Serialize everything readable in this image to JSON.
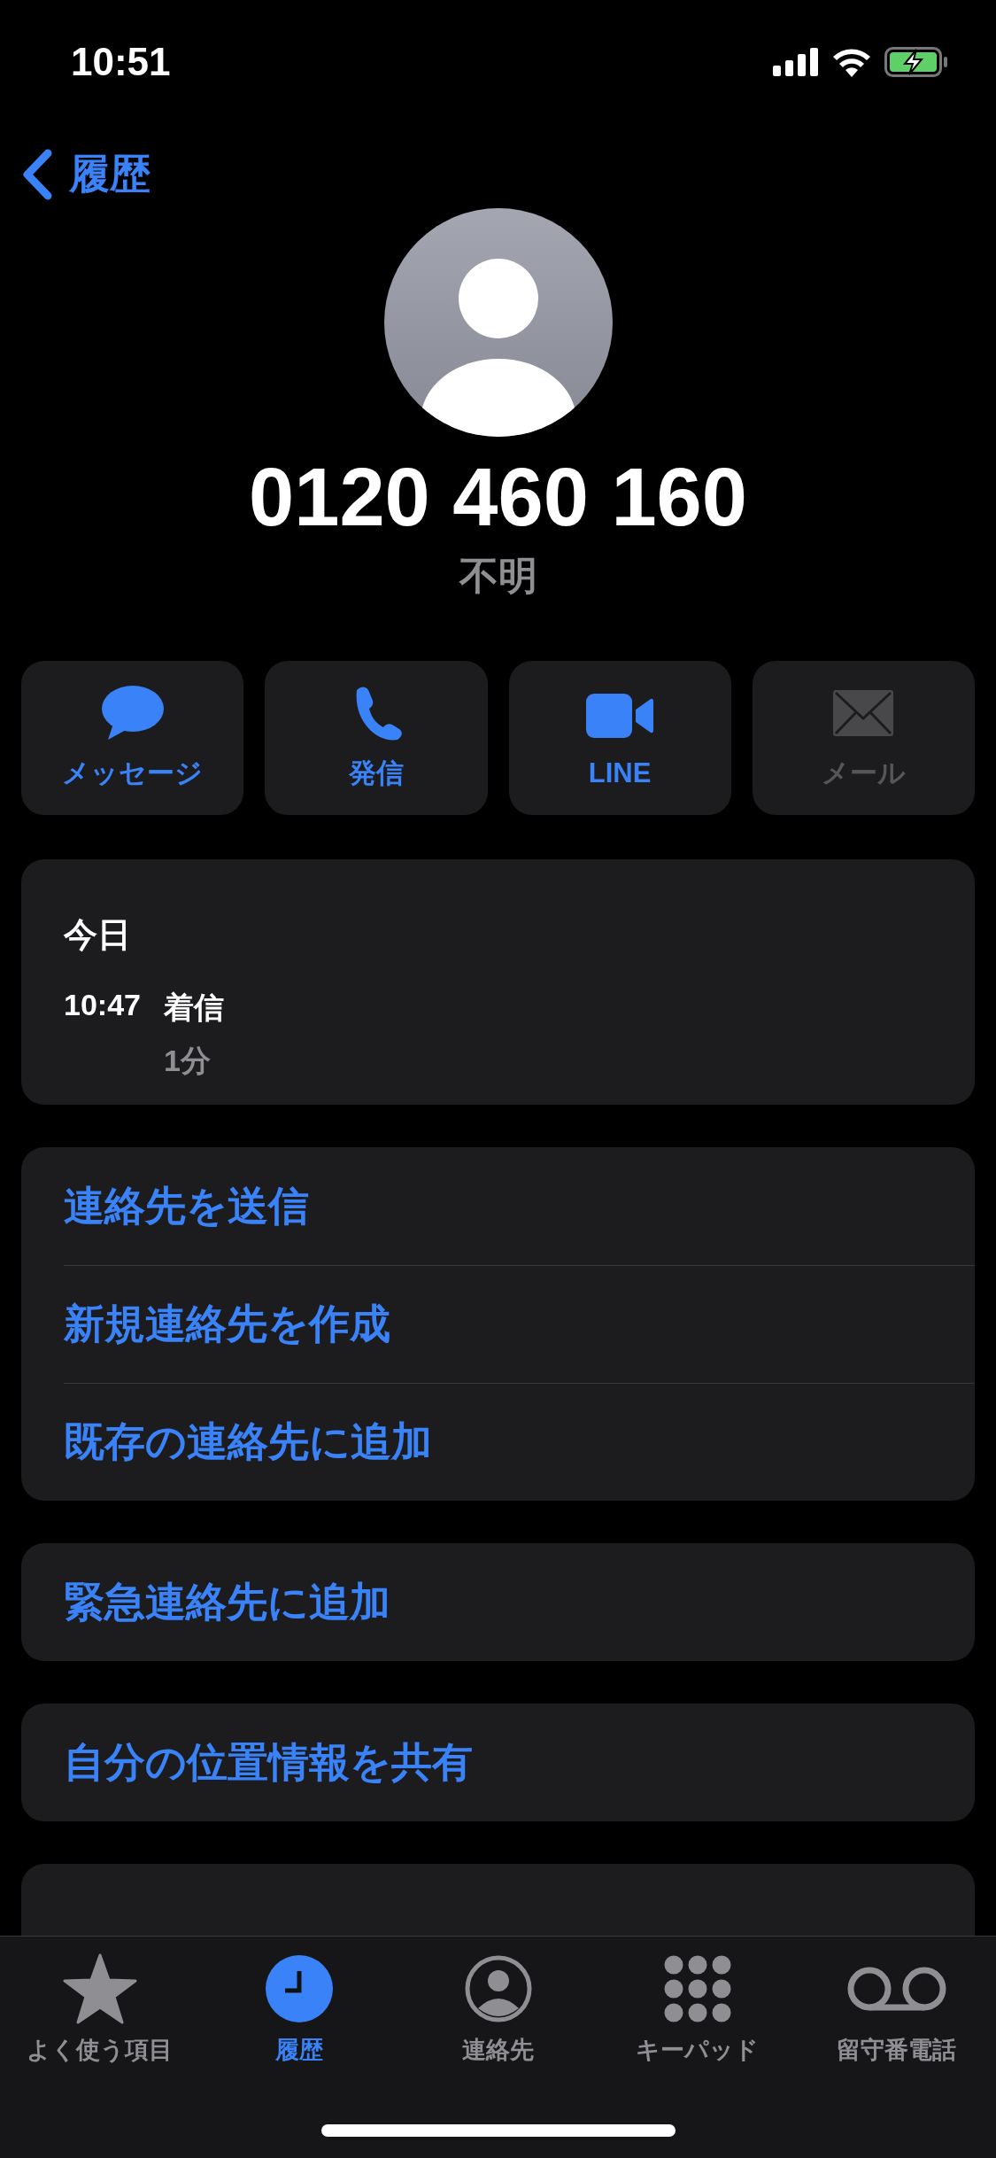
{
  "status_bar": {
    "time": "10:51"
  },
  "nav": {
    "back_label": "履歴"
  },
  "contact": {
    "number": "0120 460 160",
    "label": "不明"
  },
  "actions": [
    {
      "kind": "message",
      "label": "メッセージ",
      "disabled": false
    },
    {
      "kind": "call",
      "label": "発信",
      "disabled": false
    },
    {
      "kind": "video",
      "label": "LINE",
      "disabled": false
    },
    {
      "kind": "mail",
      "label": "メール",
      "disabled": true
    }
  ],
  "recent_calls": {
    "date": "今日",
    "entries": [
      {
        "time": "10:47",
        "type": "着信",
        "duration": "1分"
      }
    ]
  },
  "option_groups": [
    [
      "連絡先を送信",
      "新規連絡先を作成",
      "既存の連絡先に追加"
    ],
    [
      "緊急連絡先に追加"
    ],
    [
      "自分の位置情報を共有"
    ]
  ],
  "tab_bar": [
    {
      "kind": "favorites",
      "label": "よく使う項目",
      "selected": false
    },
    {
      "kind": "recents",
      "label": "履歴",
      "selected": true
    },
    {
      "kind": "contacts",
      "label": "連絡先",
      "selected": false
    },
    {
      "kind": "keypad",
      "label": "キーパッド",
      "selected": false
    },
    {
      "kind": "voicemail",
      "label": "留守番電話",
      "selected": false
    }
  ]
}
